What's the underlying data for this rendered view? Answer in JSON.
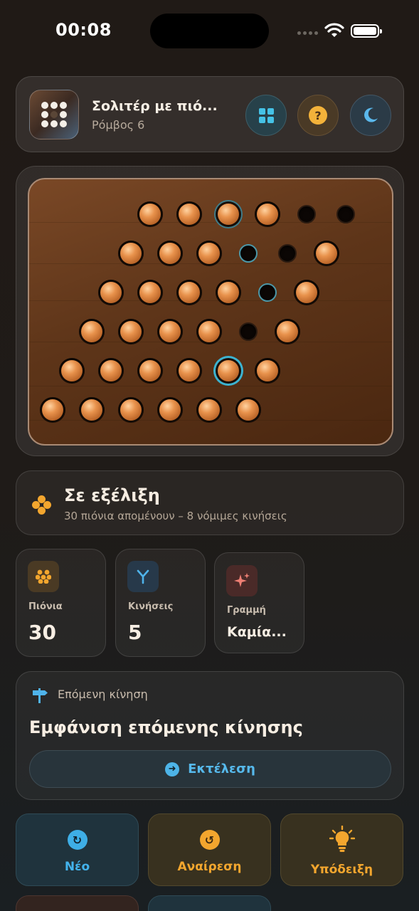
{
  "status_bar": {
    "time": "00:08"
  },
  "header": {
    "title": "Σολιτέρ με πιό...",
    "subtitle": "Ρόμβος 6",
    "buttons": [
      "layout-grid-icon",
      "help-icon",
      "moon-icon"
    ]
  },
  "board": {
    "rows": [
      [
        "peg",
        "peg",
        "peg-highlight",
        "peg",
        "empty",
        "empty"
      ],
      [
        "peg",
        "peg",
        "peg",
        "empty-highlight",
        "empty",
        "peg"
      ],
      [
        "peg",
        "peg",
        "peg",
        "peg",
        "empty-highlight",
        "peg"
      ],
      [
        "peg",
        "peg",
        "peg",
        "peg",
        "empty",
        "peg"
      ],
      [
        "peg",
        "peg",
        "peg",
        "peg",
        "peg-selected",
        "peg"
      ],
      [
        "peg",
        "peg",
        "peg",
        "peg",
        "peg",
        "peg"
      ]
    ],
    "accent_color": "#3cb3d0"
  },
  "status": {
    "title": "Σε εξέλιξη",
    "subtitle": "30 πιόνια απομένουν – 8 νόμιμες κινήσεις"
  },
  "stats": [
    {
      "label": "Πιόνια",
      "value": "30",
      "icon": "pegs-icon"
    },
    {
      "label": "Κινήσεις",
      "value": "5",
      "icon": "moves-icon"
    },
    {
      "label": "Γραμμή",
      "value": "Καμία...",
      "icon": "sparkle-icon"
    }
  ],
  "next_move": {
    "heading": "Επόμενη κίνηση",
    "title": "Εμφάνιση επόμενης κίνησης",
    "execute_label": "Εκτέλεση"
  },
  "actions": {
    "new_label": "Νέο",
    "undo_label": "Αναίρεση",
    "hint_label": "Υπόδειξη"
  }
}
